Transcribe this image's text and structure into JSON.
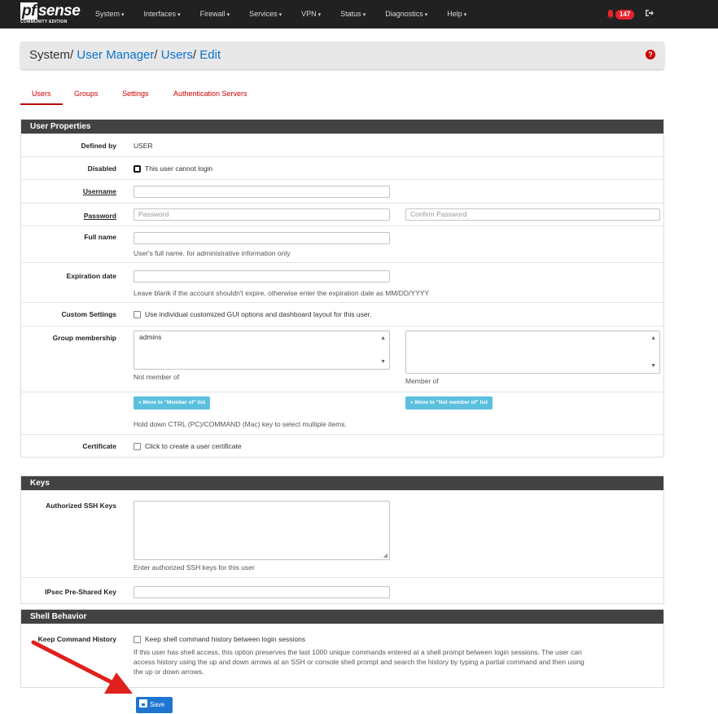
{
  "navbar": {
    "logo_main": "sense",
    "logo_pf": "pf",
    "logo_sub": "COMMUNITY EDITION",
    "menu": [
      "System",
      "Interfaces",
      "Firewall",
      "Services",
      "VPN",
      "Status",
      "Diagnostics",
      "Help"
    ],
    "alert_count": "147"
  },
  "breadcrumb": {
    "root": "System",
    "sep": "/",
    "links": [
      "User Manager",
      "Users",
      "Edit"
    ]
  },
  "tabs": [
    "Users",
    "Groups",
    "Settings",
    "Authentication Servers"
  ],
  "user_properties": {
    "title": "User Properties",
    "defined_by_label": "Defined by",
    "defined_by_value": "USER",
    "disabled_label": "Disabled",
    "disabled_text": "This user cannot login",
    "username_label": "Username",
    "username_value": "",
    "password_label": "Password",
    "password_placeholder": "Password",
    "confirm_placeholder": "Confirm Password",
    "fullname_label": "Full name",
    "fullname_help": "User's full name, for administrative information only",
    "expiration_label": "Expiration date",
    "expiration_help": "Leave blank if the account shouldn't expire, otherwise enter the expiration date as MM/DD/YYYY",
    "custom_label": "Custom Settings",
    "custom_text": "Use individual customized GUI options and dashboard layout for this user.",
    "group_label": "Group membership",
    "not_member_options": [
      "admins"
    ],
    "not_member_caption": "Not member of",
    "member_caption": "Member of",
    "move_to_member": "Move to \"Member of\" list",
    "move_to_not_member": "Move to \"Not member of\" list",
    "move_help": "Hold down CTRL (PC)/COMMAND (Mac) key to select multiple items.",
    "certificate_label": "Certificate",
    "certificate_text": "Click to create a user certificate"
  },
  "keys": {
    "title": "Keys",
    "ssh_label": "Authorized SSH Keys",
    "ssh_help": "Enter authorized SSH keys for this user",
    "ipsec_label": "IPsec Pre-Shared Key"
  },
  "shell": {
    "title": "Shell Behavior",
    "history_label": "Keep Command History",
    "history_text": "Keep shell command history between login sessions",
    "history_help_1": "If this user has shell access, this option preserves the last 1000 unique commands entered at a shell prompt between login sessions. The user can",
    "history_help_2": "access history using the up and down arrows at an SSH or console shell prompt and search the history by typing a partial command and then using",
    "history_help_3": "the up or down arrows."
  },
  "save_label": "Save",
  "colors": {
    "navbar": "#212121",
    "link": "#0b73d1",
    "tab_active": "#c00000",
    "panel_header": "#424242",
    "info_button": "#5bc0de",
    "primary_button": "#1e76d1",
    "annotation_arrow": "#e0201c"
  },
  "icons": {
    "alerts": "bell-icon",
    "logout": "sign-out-icon",
    "help": "question-circle-icon",
    "save": "floppy-disk-icon",
    "move_right": "double-chevron-right-icon",
    "move_left": "double-chevron-left-icon"
  }
}
